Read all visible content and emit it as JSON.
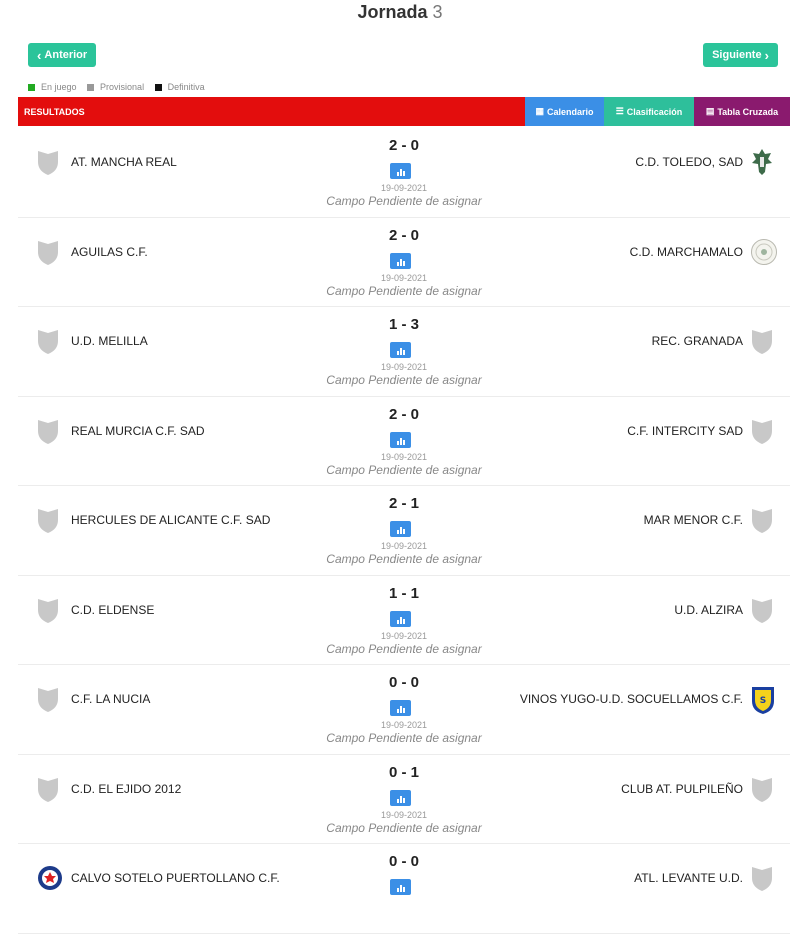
{
  "header": {
    "title": "Jornada",
    "number": "3"
  },
  "nav": {
    "prev_label": "Anterior",
    "next_label": "Siguiente"
  },
  "legend": [
    {
      "label": "En juego",
      "color": "#22aa22"
    },
    {
      "label": "Provisional",
      "color": "#999999"
    },
    {
      "label": "Definitiva",
      "color": "#111111"
    }
  ],
  "bar": {
    "title": "RESULTADOS",
    "tabs": [
      {
        "label": "Calendario",
        "icon": "calendar-icon"
      },
      {
        "label": "Clasificación",
        "icon": "list-icon"
      },
      {
        "label": "Tabla Cruzada",
        "icon": "table-icon"
      }
    ]
  },
  "matches": [
    {
      "home": "AT. MANCHA REAL",
      "away": "C.D. TOLEDO, SAD",
      "score": "2 - 0",
      "date": "19-09-2021",
      "field": "Campo Pendiente de asignar",
      "home_crest": "generic",
      "away_crest": "toledo"
    },
    {
      "home": "AGUILAS C.F.",
      "away": "C.D. MARCHAMALO",
      "score": "2 - 0",
      "date": "19-09-2021",
      "field": "Campo Pendiente de asignar",
      "home_crest": "generic",
      "away_crest": "round"
    },
    {
      "home": "U.D. MELILLA",
      "away": "REC. GRANADA",
      "score": "1 - 3",
      "date": "19-09-2021",
      "field": "Campo Pendiente de asignar",
      "home_crest": "generic",
      "away_crest": "generic"
    },
    {
      "home": "REAL MURCIA C.F. SAD",
      "away": "C.F. INTERCITY SAD",
      "score": "2 - 0",
      "date": "19-09-2021",
      "field": "Campo Pendiente de asignar",
      "home_crest": "generic",
      "away_crest": "generic"
    },
    {
      "home": "HERCULES DE ALICANTE C.F. SAD",
      "away": "MAR MENOR C.F.",
      "score": "2 - 1",
      "date": "19-09-2021",
      "field": "Campo Pendiente de asignar",
      "home_crest": "generic",
      "away_crest": "generic"
    },
    {
      "home": "C.D. ELDENSE",
      "away": "U.D. ALZIRA",
      "score": "1 - 1",
      "date": "19-09-2021",
      "field": "Campo Pendiente de asignar",
      "home_crest": "generic",
      "away_crest": "generic"
    },
    {
      "home": "C.F. LA NUCIA",
      "away": "VINOS YUGO-U.D. SOCUELLAMOS C.F.",
      "score": "0 - 0",
      "date": "19-09-2021",
      "field": "Campo Pendiente de asignar",
      "home_crest": "generic",
      "away_crest": "socuellamos"
    },
    {
      "home": "C.D. EL EJIDO 2012",
      "away": "CLUB AT. PULPILEÑO",
      "score": "0 - 1",
      "date": "19-09-2021",
      "field": "Campo Pendiente de asignar",
      "home_crest": "generic",
      "away_crest": "generic"
    },
    {
      "home": "CALVO SOTELO PUERTOLLANO C.F.",
      "away": "ATL. LEVANTE U.D.",
      "score": "0 - 0",
      "date": "",
      "field": "",
      "home_crest": "calvo",
      "away_crest": "generic"
    }
  ],
  "colors": {
    "accent": "#2bc49a",
    "results_bar": "#e30d0d",
    "calendar_tab": "#3b8fe6",
    "clasificacion_tab": "#2ebf9b",
    "tabla_tab": "#8a1a6e"
  }
}
